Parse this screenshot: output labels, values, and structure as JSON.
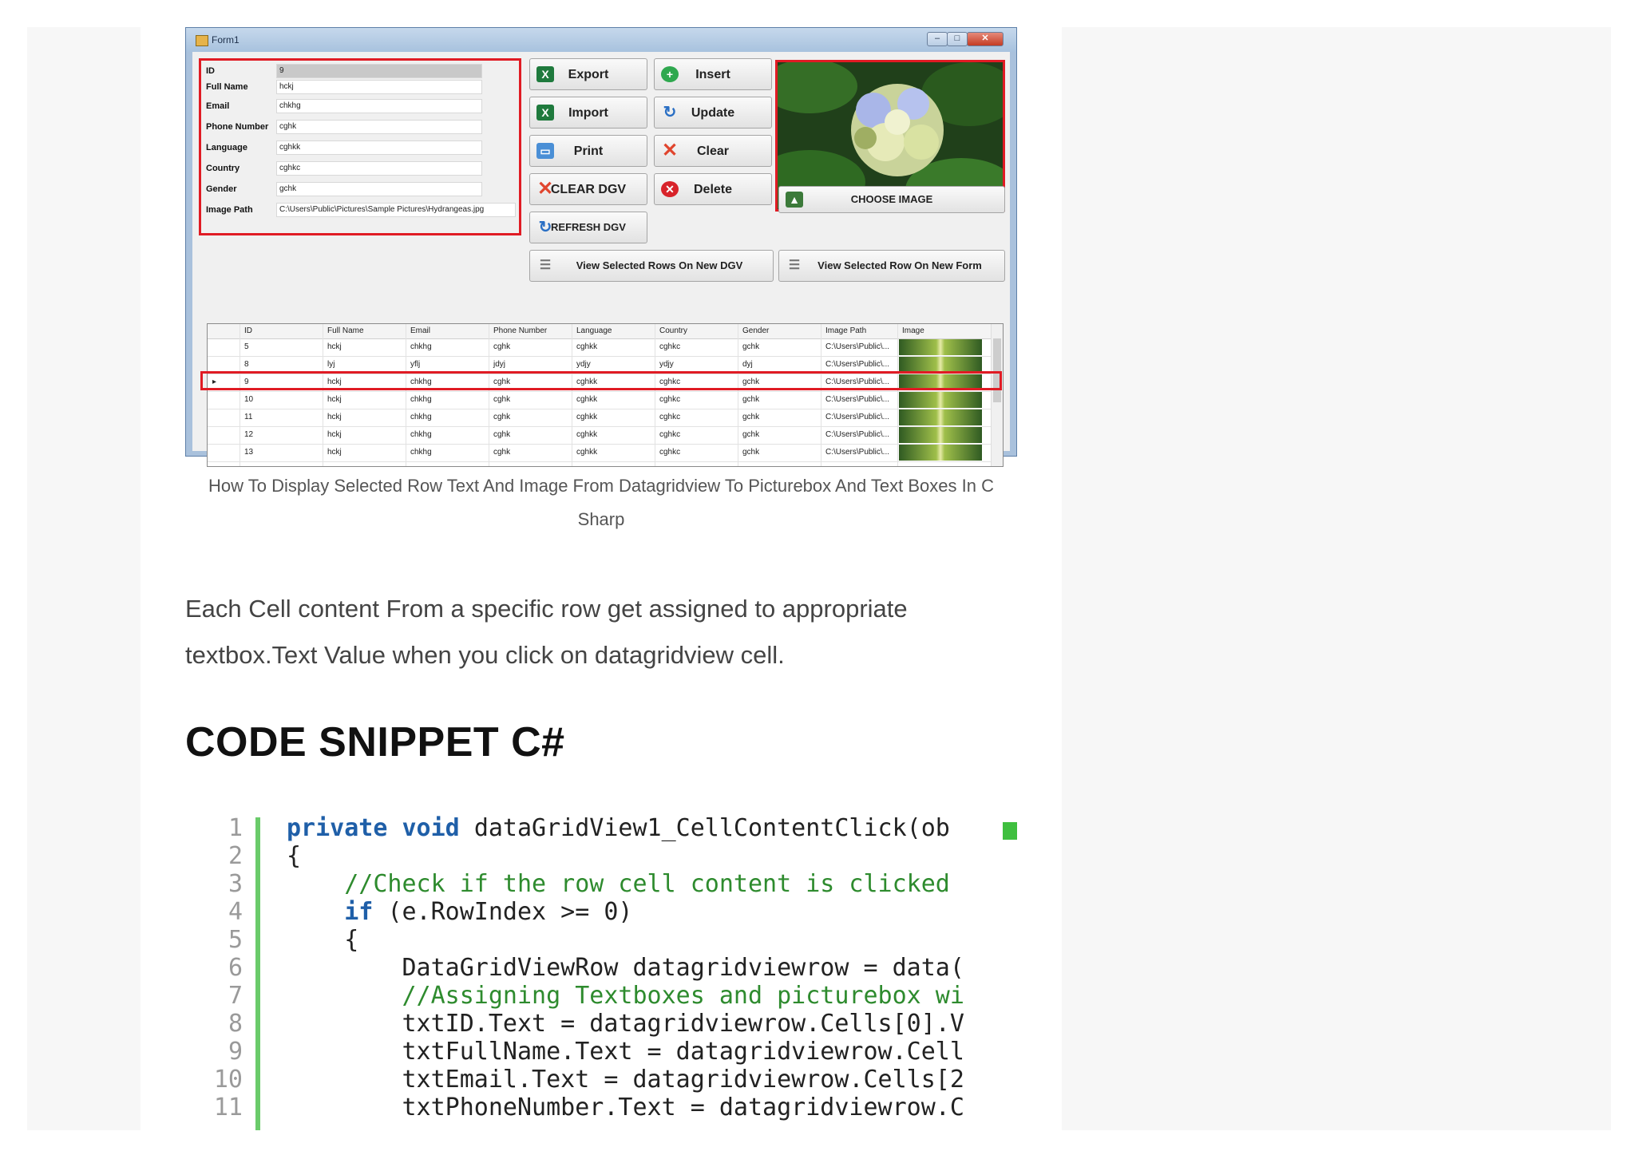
{
  "window": {
    "title": "Form1",
    "controls": {
      "minimize": "–",
      "maximize": "□",
      "close": "✕"
    }
  },
  "fields": [
    {
      "label": "ID",
      "value": "9"
    },
    {
      "label": "Full Name",
      "value": "hckj"
    },
    {
      "label": "Email",
      "value": "chkhg"
    },
    {
      "label": "Phone Number",
      "value": "cghk"
    },
    {
      "label": "Language",
      "value": "cghkk"
    },
    {
      "label": "Country",
      "value": "cghkc"
    },
    {
      "label": "Gender",
      "value": "gchk"
    },
    {
      "label": "Image Path",
      "value": "C:\\Users\\Public\\Pictures\\Sample Pictures\\Hydrangeas.jpg"
    }
  ],
  "buttons": {
    "export": "Export",
    "insert": "Insert",
    "import": "Import",
    "update": "Update",
    "print": "Print",
    "clear": "Clear",
    "clear_dgv": "CLEAR DGV",
    "delete": "Delete",
    "refresh_dgv": "REFRESH DGV",
    "choose_image": "CHOOSE IMAGE",
    "view_rows_new_dgv": "View Selected Rows On New DGV",
    "view_row_new_form": "View Selected Row On New Form"
  },
  "grid": {
    "columns": [
      "ID",
      "Full Name",
      "Email",
      "Phone Number",
      "Language",
      "Country",
      "Gender",
      "Image Path",
      "Image"
    ],
    "selected_row_index": 2,
    "rows": [
      [
        "5",
        "hckj",
        "chkhg",
        "cghk",
        "cghkk",
        "cghkc",
        "gchk",
        "C:\\Users\\Public\\..."
      ],
      [
        "8",
        "lyj",
        "yflj",
        "jdyj",
        "ydjy",
        "ydjy",
        "dyj",
        "C:\\Users\\Public\\..."
      ],
      [
        "9",
        "hckj",
        "chkhg",
        "cghk",
        "cghkk",
        "cghkc",
        "gchk",
        "C:\\Users\\Public\\..."
      ],
      [
        "10",
        "hckj",
        "chkhg",
        "cghk",
        "cghkk",
        "cghkc",
        "gchk",
        "C:\\Users\\Public\\..."
      ],
      [
        "11",
        "hckj",
        "chkhg",
        "cghk",
        "cghkk",
        "cghkc",
        "gchk",
        "C:\\Users\\Public\\..."
      ],
      [
        "12",
        "hckj",
        "chkhg",
        "cghk",
        "cghkk",
        "cghkc",
        "gchk",
        "C:\\Users\\Public\\..."
      ],
      [
        "13",
        "hckj",
        "chkhg",
        "cghk",
        "cghkk",
        "cghkc",
        "gchk",
        "C:\\Users\\Public\\..."
      ]
    ]
  },
  "caption": {
    "line1": "How To Display Selected Row Text And Image From Datagridview To Picturebox And Text Boxes In C",
    "line2": "Sharp"
  },
  "paragraph": {
    "line1": "Each Cell content From a specific row get assigned to appropriate",
    "line2": "textbox.Text Value when you click on datagridview cell."
  },
  "heading": "CODE SNIPPET C#",
  "code": {
    "line_numbers": [
      "1",
      "2",
      "3",
      "4",
      "5",
      "6",
      "7",
      "8",
      "9",
      "10",
      "11"
    ],
    "lines": [
      {
        "indent": "",
        "kw": "private void ",
        "text": "dataGridView1_CellContentClick(ob",
        "comment": ""
      },
      {
        "indent": "",
        "kw": "",
        "text": "{",
        "comment": ""
      },
      {
        "indent": "    ",
        "kw": "",
        "text": "",
        "comment": "//Check if the row cell content is clicked"
      },
      {
        "indent": "    ",
        "kw": "if ",
        "text": "(e.RowIndex >= 0)",
        "comment": ""
      },
      {
        "indent": "    ",
        "kw": "",
        "text": "{",
        "comment": ""
      },
      {
        "indent": "        ",
        "kw": "",
        "text": "DataGridViewRow datagridviewrow = data(",
        "comment": ""
      },
      {
        "indent": "        ",
        "kw": "",
        "text": "",
        "comment": "//Assigning Textboxes and picturebox wi"
      },
      {
        "indent": "        ",
        "kw": "",
        "text": "txtID.Text = datagridviewrow.Cells[0].V",
        "comment": ""
      },
      {
        "indent": "        ",
        "kw": "",
        "text": "txtFullName.Text = datagridviewrow.Cell",
        "comment": ""
      },
      {
        "indent": "        ",
        "kw": "",
        "text": "txtEmail.Text = datagridviewrow.Cells[2",
        "comment": ""
      },
      {
        "indent": "        ",
        "kw": "",
        "text": "txtPhoneNumber.Text = datagridviewrow.C",
        "comment": ""
      }
    ]
  },
  "colors": {
    "highlight": "#e01b24",
    "code_keyword": "#1f5fa8",
    "code_comment": "#2e8b2e",
    "gutter": "#6acb6a"
  }
}
